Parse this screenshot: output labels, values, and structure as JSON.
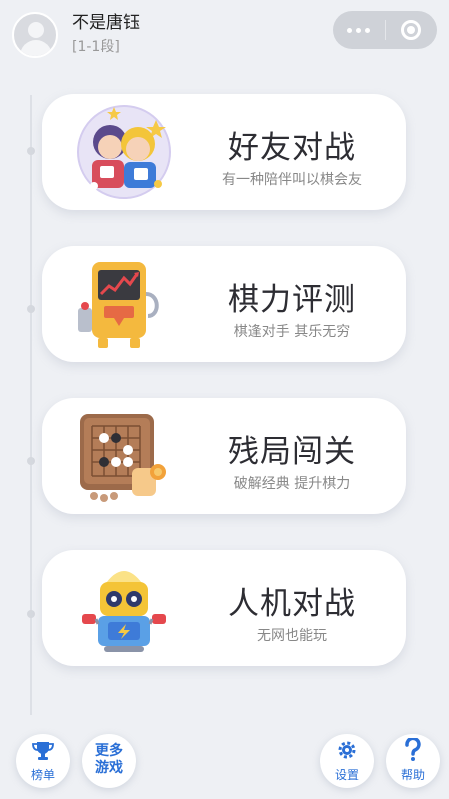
{
  "header": {
    "username": "不是唐钰",
    "rank": "[1-1段]"
  },
  "menu": [
    {
      "title": "好友对战",
      "subtitle": "有一种陪伴叫以棋会友",
      "icon": "friends-battle-icon"
    },
    {
      "title": "棋力评测",
      "subtitle": "棋逢对手 其乐无穷",
      "icon": "rating-machine-icon"
    },
    {
      "title": "残局闯关",
      "subtitle": "破解经典 提升棋力",
      "icon": "go-board-icon"
    },
    {
      "title": "人机对战",
      "subtitle": "无网也能玩",
      "icon": "robot-icon"
    }
  ],
  "bottom": {
    "leaderboard": "榜单",
    "more_games_1": "更多",
    "more_games_2": "游戏",
    "settings": "设置",
    "help": "帮助"
  },
  "colors": {
    "accent": "#2a6fd6",
    "background": "#eef0f4"
  }
}
